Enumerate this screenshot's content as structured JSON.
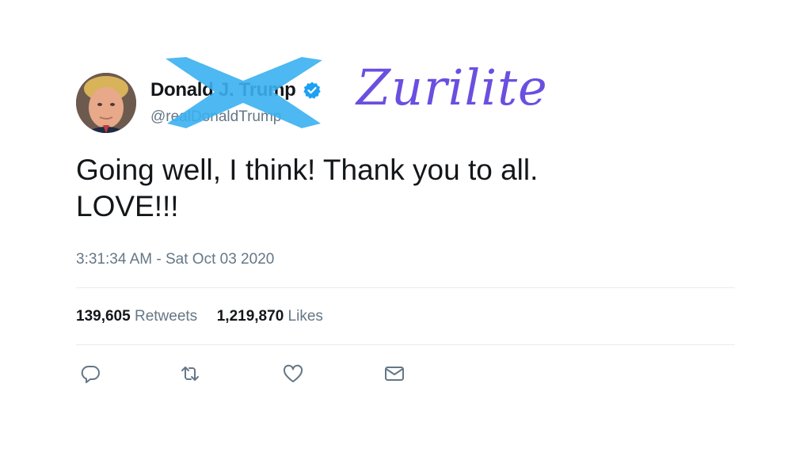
{
  "tweet": {
    "author": {
      "display_name": "Donald J. Trump",
      "handle": "@realDonaldTrump",
      "verified": true,
      "avatar_icon": "profile-avatar"
    },
    "overlay": {
      "name": "Zurilite",
      "color": "#6a4fe0",
      "strike_color": "#3ab0f0"
    },
    "text_line1": "Going well, I think! Thank you to all.",
    "text_line2": "LOVE!!!",
    "timestamp": "3:31:34 AM - Sat Oct 03 2020",
    "stats": {
      "retweets_count": "139,605",
      "retweets_label": "Retweets",
      "likes_count": "1,219,870",
      "likes_label": "Likes"
    },
    "actions": [
      {
        "icon": "reply-icon"
      },
      {
        "icon": "retweet-icon"
      },
      {
        "icon": "like-icon"
      },
      {
        "icon": "message-icon"
      }
    ],
    "colors": {
      "primary_text": "#14171a",
      "secondary_text": "#657786",
      "verified_blue": "#1da1f2",
      "divider": "#e6ecf0"
    }
  }
}
